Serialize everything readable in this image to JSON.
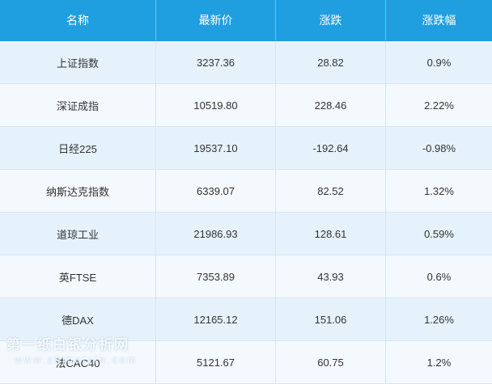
{
  "table": {
    "headers": [
      "名称",
      "最新价",
      "涨跌",
      "涨跌幅"
    ],
    "rows": [
      [
        "上证指数",
        "3237.36",
        "28.82",
        "0.9%"
      ],
      [
        "深证成指",
        "10519.80",
        "228.46",
        "2.22%"
      ],
      [
        "日经225",
        "19537.10",
        "-192.64",
        "-0.98%"
      ],
      [
        "纳斯达克指数",
        "6339.07",
        "82.52",
        "1.32%"
      ],
      [
        "道琼工业",
        "21986.93",
        "128.61",
        "0.59%"
      ],
      [
        "英FTSE",
        "7353.89",
        "43.93",
        "0.6%"
      ],
      [
        "德DAX",
        "12165.12",
        "151.06",
        "1.26%"
      ],
      [
        "法CAC40",
        "5121.67",
        "60.75",
        "1.2%"
      ]
    ]
  },
  "watermark": {
    "text": "第一纸白银分析网",
    "sub": "www.zhibaiyin.com"
  },
  "colors": {
    "header_bg": "#1f9ee0",
    "row_odd": "#e6f2fb",
    "row_even": "#f3f9fd"
  }
}
